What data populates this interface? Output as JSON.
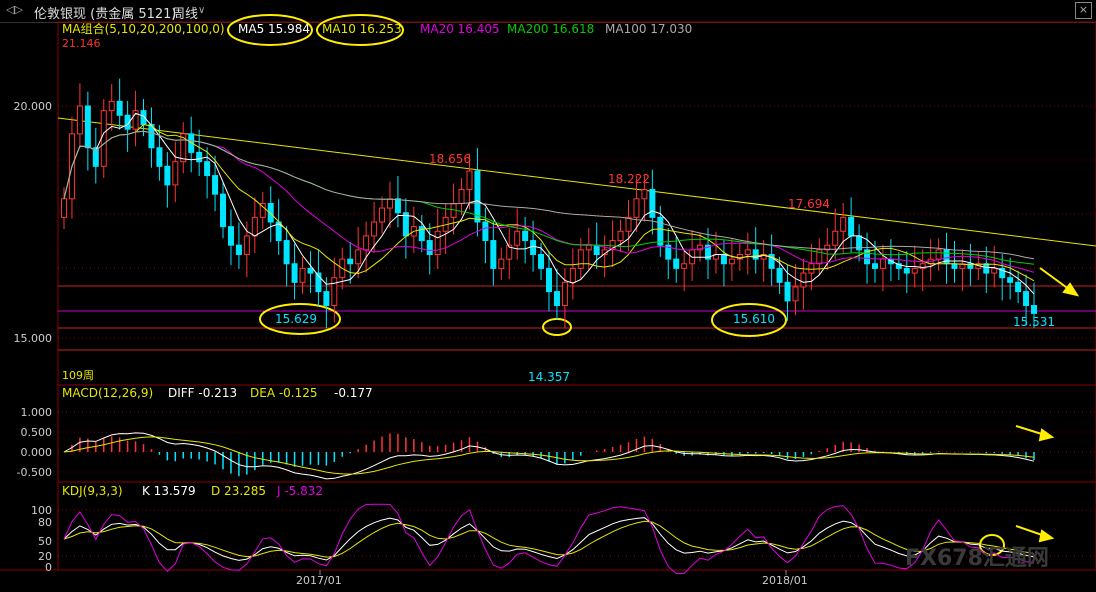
{
  "header": {
    "back_icon": "back-icon",
    "instrument": "伦敦银现 (贵金属 5121)",
    "period": "周线",
    "period_dropdown_icon": "chevron-down-icon",
    "close_icon": "close-icon"
  },
  "ma_legend": {
    "group": "MA组合(5,10,20,200,100,0)",
    "ma5": "MA5 15.984",
    "ma10": "MA10 16.253",
    "ma20": "MA20 16.405",
    "ma200": "MA200 16.618",
    "ma100": "MA100 17.030"
  },
  "price_labels": {
    "high": "21.146",
    "peak1": "18.656",
    "peak2": "18.222",
    "peak3": "17.694",
    "low1": "15.629",
    "low2": "14.357",
    "low3": "15.610",
    "last": "15.531"
  },
  "volume_label": "109周",
  "macd_legend": {
    "title": "MACD(12,26,9)",
    "diff": "DIFF -0.213",
    "dea": "DEA -0.125",
    "macd": "-0.177"
  },
  "kdj_legend": {
    "title": "KDJ(9,3,3)",
    "k": "K 13.579",
    "d": "D 23.285",
    "j": "J -5.832"
  },
  "x_axis_labels": [
    "2017/01",
    "2018/01"
  ],
  "watermark": "FX678汇通网",
  "colors": {
    "up": "#ff3333",
    "down": "#00e5ff",
    "ma5": "#ffffff",
    "ma10": "#e6e600",
    "ma20": "#e000e0",
    "ma200": "#00cc00",
    "ma100": "#aaaaaa",
    "annotation": "#ffee00",
    "grid": "#8b0000"
  },
  "chart_data": {
    "type": "candlestick",
    "price_axis": {
      "ticks": [
        20.0,
        15.0
      ],
      "ylim": [
        14.3,
        21.4
      ]
    },
    "close_series": [
      18.0,
      19.4,
      20.0,
      19.1,
      18.7,
      19.9,
      20.1,
      19.8,
      19.5,
      19.9,
      19.6,
      19.1,
      18.7,
      18.3,
      18.8,
      19.4,
      19.0,
      18.8,
      18.5,
      18.1,
      17.4,
      17.0,
      16.8,
      17.2,
      17.6,
      17.9,
      17.5,
      17.1,
      16.6,
      16.2,
      16.5,
      16.4,
      16.0,
      15.7,
      16.3,
      16.7,
      16.6,
      16.9,
      17.2,
      17.5,
      17.8,
      18.0,
      17.7,
      17.2,
      17.4,
      17.1,
      16.8,
      17.3,
      17.6,
      17.9,
      18.2,
      18.6,
      17.5,
      17.1,
      16.5,
      16.7,
      17.0,
      17.3,
      17.1,
      16.8,
      16.5,
      16.0,
      15.7,
      16.2,
      16.5,
      16.9,
      17.0,
      16.8,
      16.9,
      17.1,
      17.3,
      17.6,
      18.0,
      18.2,
      17.6,
      17.0,
      16.7,
      16.5,
      16.6,
      16.9,
      17.0,
      16.7,
      16.8,
      16.6,
      16.7,
      16.8,
      16.9,
      16.7,
      16.8,
      16.5,
      16.2,
      15.8,
      16.1,
      16.4,
      16.6,
      16.9,
      17.0,
      17.3,
      17.6,
      17.2,
      16.9,
      16.6,
      16.5,
      16.7,
      16.6,
      16.5,
      16.4,
      16.5,
      16.6,
      16.7,
      16.9,
      16.6,
      16.5,
      16.6,
      16.5,
      16.6,
      16.4,
      16.5,
      16.3,
      16.2,
      16.0,
      15.7,
      15.53
    ],
    "macd_axis": {
      "ticks": [
        1.0,
        0.5,
        0.0,
        -0.5
      ]
    },
    "kdj_axis": {
      "ticks": [
        100,
        80,
        50,
        20,
        0
      ]
    },
    "annotations": [
      "15.629",
      "14.357",
      "15.610",
      "15.531"
    ]
  }
}
